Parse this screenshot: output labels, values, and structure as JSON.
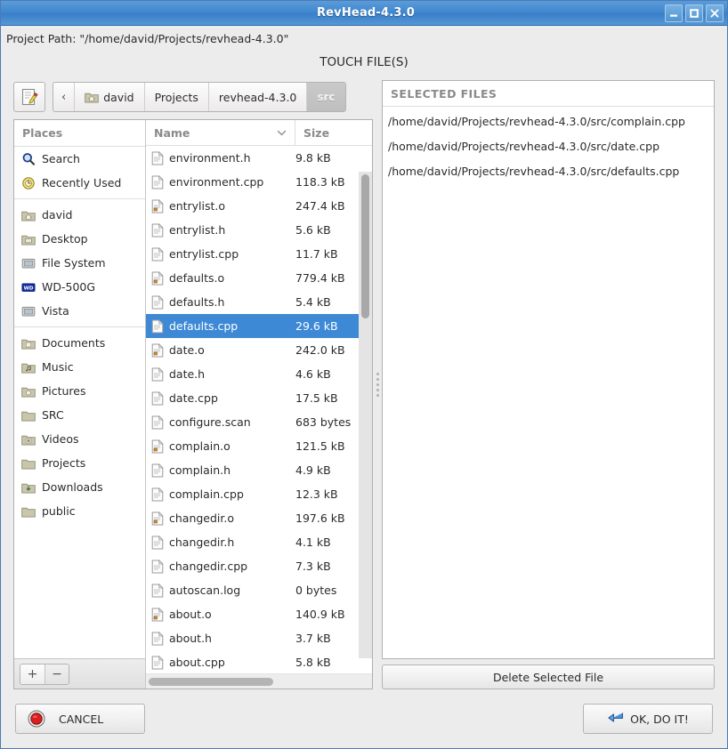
{
  "window": {
    "title": "RevHead-4.3.0",
    "buttons": [
      {
        "name": "minimize",
        "glyph": "minimize-icon"
      },
      {
        "name": "maximize",
        "glyph": "maximize-icon"
      },
      {
        "name": "close",
        "glyph": "close-icon"
      }
    ],
    "accent_color": "#4189cf",
    "selection_color": "#3e89d6"
  },
  "header": {
    "project_path": "Project Path: \"/home/david/Projects/revhead-4.3.0\"",
    "heading": "TOUCH FILE(S)"
  },
  "pathbar": {
    "edit_icon": "edit-pencil-icon",
    "back_label": "‹",
    "crumbs": [
      {
        "label": "david",
        "icon": "home-folder-icon",
        "active": false
      },
      {
        "label": "Projects",
        "icon": "",
        "active": false
      },
      {
        "label": "revhead-4.3.0",
        "icon": "",
        "active": false
      },
      {
        "label": "src",
        "icon": "",
        "active": true
      }
    ]
  },
  "places": {
    "header": "Places",
    "groups": [
      [
        {
          "label": "Search",
          "icon": "search-icon"
        },
        {
          "label": "Recently Used",
          "icon": "recent-clock-icon"
        }
      ],
      [
        {
          "label": "david",
          "icon": "home-folder-icon"
        },
        {
          "label": "Desktop",
          "icon": "desktop-folder-icon"
        },
        {
          "label": "File System",
          "icon": "drive-icon"
        },
        {
          "label": "WD-500G",
          "icon": "wd-drive-icon"
        },
        {
          "label": "Vista",
          "icon": "drive-icon"
        }
      ],
      [
        {
          "label": "Documents",
          "icon": "documents-folder-icon"
        },
        {
          "label": "Music",
          "icon": "music-folder-icon"
        },
        {
          "label": "Pictures",
          "icon": "pictures-folder-icon"
        },
        {
          "label": "SRC",
          "icon": "folder-icon"
        },
        {
          "label": "Videos",
          "icon": "videos-folder-icon"
        },
        {
          "label": "Projects",
          "icon": "folder-icon"
        },
        {
          "label": "Downloads",
          "icon": "downloads-folder-icon"
        },
        {
          "label": "public",
          "icon": "folder-icon"
        }
      ]
    ],
    "add_label": "+",
    "remove_label": "−"
  },
  "filelist": {
    "columns": {
      "name": "Name",
      "size": "Size"
    },
    "sort_icon": "chevron-down-icon",
    "rows": [
      {
        "name": "about.cpp",
        "size": "5.8 kB",
        "icon": "text-file-icon",
        "selected": false
      },
      {
        "name": "about.h",
        "size": "3.7 kB",
        "icon": "text-file-icon",
        "selected": false
      },
      {
        "name": "about.o",
        "size": "140.9 kB",
        "icon": "object-file-icon",
        "selected": false
      },
      {
        "name": "autoscan.log",
        "size": "0 bytes",
        "icon": "text-file-icon",
        "selected": false
      },
      {
        "name": "changedir.cpp",
        "size": "7.3 kB",
        "icon": "text-file-icon",
        "selected": false
      },
      {
        "name": "changedir.h",
        "size": "4.1 kB",
        "icon": "text-file-icon",
        "selected": false
      },
      {
        "name": "changedir.o",
        "size": "197.6 kB",
        "icon": "object-file-icon",
        "selected": false
      },
      {
        "name": "complain.cpp",
        "size": "12.3 kB",
        "icon": "text-file-icon",
        "selected": false
      },
      {
        "name": "complain.h",
        "size": "4.9 kB",
        "icon": "text-file-icon",
        "selected": false
      },
      {
        "name": "complain.o",
        "size": "121.5 kB",
        "icon": "object-file-icon",
        "selected": false
      },
      {
        "name": "configure.scan",
        "size": "683 bytes",
        "icon": "text-file-icon",
        "selected": false
      },
      {
        "name": "date.cpp",
        "size": "17.5 kB",
        "icon": "text-file-icon",
        "selected": false
      },
      {
        "name": "date.h",
        "size": "4.6 kB",
        "icon": "text-file-icon",
        "selected": false
      },
      {
        "name": "date.o",
        "size": "242.0 kB",
        "icon": "object-file-icon",
        "selected": false
      },
      {
        "name": "defaults.cpp",
        "size": "29.6 kB",
        "icon": "text-file-icon",
        "selected": true
      },
      {
        "name": "defaults.h",
        "size": "5.4 kB",
        "icon": "text-file-icon",
        "selected": false
      },
      {
        "name": "defaults.o",
        "size": "779.4 kB",
        "icon": "object-file-icon",
        "selected": false
      },
      {
        "name": "entrylist.cpp",
        "size": "11.7 kB",
        "icon": "text-file-icon",
        "selected": false
      },
      {
        "name": "entrylist.h",
        "size": "5.6 kB",
        "icon": "text-file-icon",
        "selected": false
      },
      {
        "name": "entrylist.o",
        "size": "247.4 kB",
        "icon": "object-file-icon",
        "selected": false
      },
      {
        "name": "environment.cpp",
        "size": "118.3 kB",
        "icon": "text-file-icon",
        "selected": false
      },
      {
        "name": "environment.h",
        "size": "9.8 kB",
        "icon": "text-file-icon",
        "selected": false
      }
    ]
  },
  "selected_files": {
    "header": "SELECTED FILES",
    "items": [
      "/home/david/Projects/revhead-4.3.0/src/complain.cpp",
      "/home/david/Projects/revhead-4.3.0/src/date.cpp",
      "/home/david/Projects/revhead-4.3.0/src/defaults.cpp"
    ],
    "delete_label": "Delete Selected File"
  },
  "footer": {
    "cancel_label": "CANCEL",
    "cancel_icon": "stop-red-icon",
    "ok_label": "OK, DO IT!",
    "ok_icon": "enter-arrow-icon"
  }
}
